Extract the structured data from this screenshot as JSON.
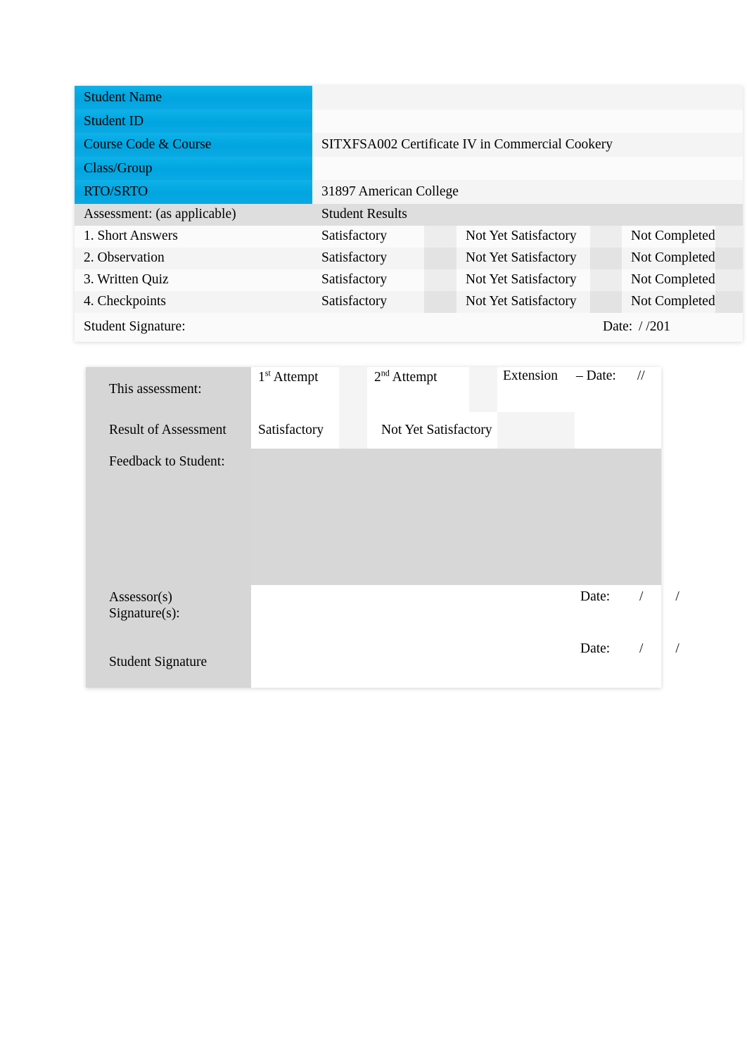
{
  "cover_table": {
    "details": [
      {
        "label": "Student Name",
        "value": ""
      },
      {
        "label": "Student ID",
        "value": ""
      },
      {
        "label": "Course Code & Course",
        "value": "SITXFSA002 Certificate IV in Commercial Cookery"
      },
      {
        "label": "Class/Group",
        "value": ""
      },
      {
        "label": "RTO/SRTO",
        "value": "31897 American College"
      }
    ],
    "assessment_header": {
      "left": "Assessment: (as applicable)",
      "right": "Student Results"
    },
    "result_options": [
      "Satisfactory",
      "Not Yet Satisfactory",
      "Not Completed"
    ],
    "assessment_rows": [
      {
        "name": "1. Short Answers",
        "results": [
          "Satisfactory",
          "Not Yet Satisfactory",
          "Not Completed"
        ]
      },
      {
        "name": "2. Observation",
        "results": [
          "Satisfactory",
          "Not Yet Satisfactory",
          "Not Completed"
        ]
      },
      {
        "name": "3. Written Quiz",
        "results": [
          "Satisfactory",
          "Not Yet Satisfactory",
          "Not Completed"
        ]
      },
      {
        "name": "4. Checkpoints",
        "results": [
          "Satisfactory",
          "Not Yet Satisfactory",
          "Not Completed"
        ]
      }
    ],
    "signature_row": {
      "label": "Student Signature:",
      "date_label": "Date:",
      "date_value": "/        /201"
    }
  },
  "outcome_table": {
    "attempt_row": {
      "label": "This assessment:",
      "first_attempt": "Attempt",
      "first_attempt_number": "1",
      "first_attempt_ordinal": "st",
      "second_attempt": "Attempt",
      "second_attempt_number": "2",
      "second_attempt_ordinal": "nd",
      "extension_label": "Extension",
      "extension_date_label": "– Date:",
      "extension_date_value": "/",
      "extension_date_value2": "/"
    },
    "result_row": {
      "label": "Result of Assessment",
      "option_satisfactory": "Satisfactory",
      "option_not_yet": "Not Yet Satisfactory"
    },
    "feedback_row": {
      "label": "Feedback to Student:",
      "value": ""
    },
    "assessor_row": {
      "label_line1": "Assessor(s)",
      "label_line2": "Signature(s):",
      "signature_value": "",
      "date_label": "Date:",
      "date_value": "/",
      "date_value2": "/"
    },
    "student_row": {
      "label": "Student Signature",
      "signature_value": "",
      "date_label": "Date:",
      "date_value": "/",
      "date_value2": "/"
    }
  },
  "colors": {
    "header_blue": "#00A5E0",
    "label_gray": "#d6d6d6",
    "feedback_gray": "#d7d7d7",
    "band_gray": "#ededed"
  }
}
